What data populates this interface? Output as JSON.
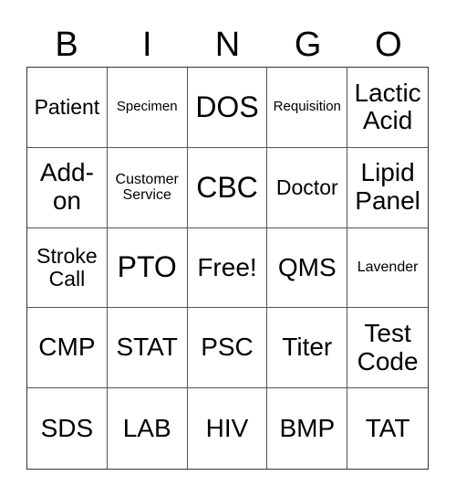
{
  "header": {
    "letters": [
      "B",
      "I",
      "N",
      "G",
      "O"
    ]
  },
  "board": {
    "rows": [
      [
        "Patient",
        "Specimen",
        "DOS",
        "Requisition",
        "Lactic\nAcid"
      ],
      [
        "Add-\non",
        "Customer\nService",
        "CBC",
        "Doctor",
        "Lipid\nPanel"
      ],
      [
        "Stroke\nCall",
        "PTO",
        "Free!",
        "QMS",
        "Lavender"
      ],
      [
        "CMP",
        "STAT",
        "PSC",
        "Titer",
        "Test\nCode"
      ],
      [
        "SDS",
        "LAB",
        "HIV",
        "BMP",
        "TAT"
      ]
    ]
  }
}
